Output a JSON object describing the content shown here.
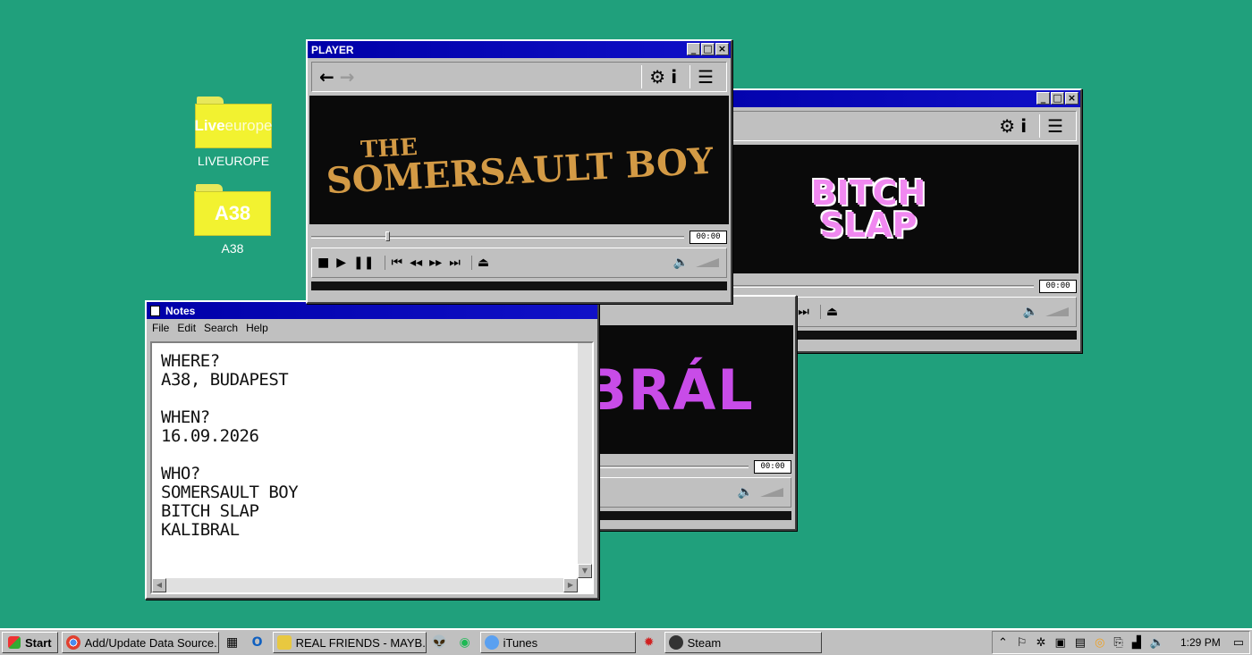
{
  "desktop": {
    "icons": [
      {
        "label": "LIVEUROPE",
        "logo_bold": "Live",
        "logo_thin": "europe"
      },
      {
        "label": "A38",
        "logo_bold": "A38",
        "logo_thin": ""
      }
    ]
  },
  "player_main": {
    "title": "PLAYER",
    "logo_the": "THE",
    "logo_main": "SOMERSAULT BOY",
    "time": "00:00",
    "seek_fraction": 0.2
  },
  "player_right": {
    "title": "",
    "logo_line1": "BITCH",
    "logo_line2": "SLAP",
    "time": "00:00",
    "seek_fraction": 0.0
  },
  "player_mid": {
    "logo": ".KALIBRÁL",
    "time": "00:00",
    "seek_fraction": 0.2
  },
  "notes": {
    "title": "Notes",
    "menu": [
      "File",
      "Edit",
      "Search",
      "Help"
    ],
    "text": "WHERE?\nA38, BUDAPEST\n\nWHEN?\n16.09.2026\n\nWHO?\nSOMERSAULT BOY\nBITCH SLAP\nKALIBRAL"
  },
  "taskbar": {
    "start": "Start",
    "tasks": [
      "Add/Update Data Source...",
      "REAL FRIENDS - MAYB...",
      "iTunes",
      "Steam"
    ],
    "clock": "1:29 PM"
  },
  "colors": {
    "desktop": "#20a07c",
    "titlebar": "#0000a8",
    "somersault": "#d39a45",
    "kalibral": "#c84ce8",
    "bitchslap": "#f088f0"
  }
}
